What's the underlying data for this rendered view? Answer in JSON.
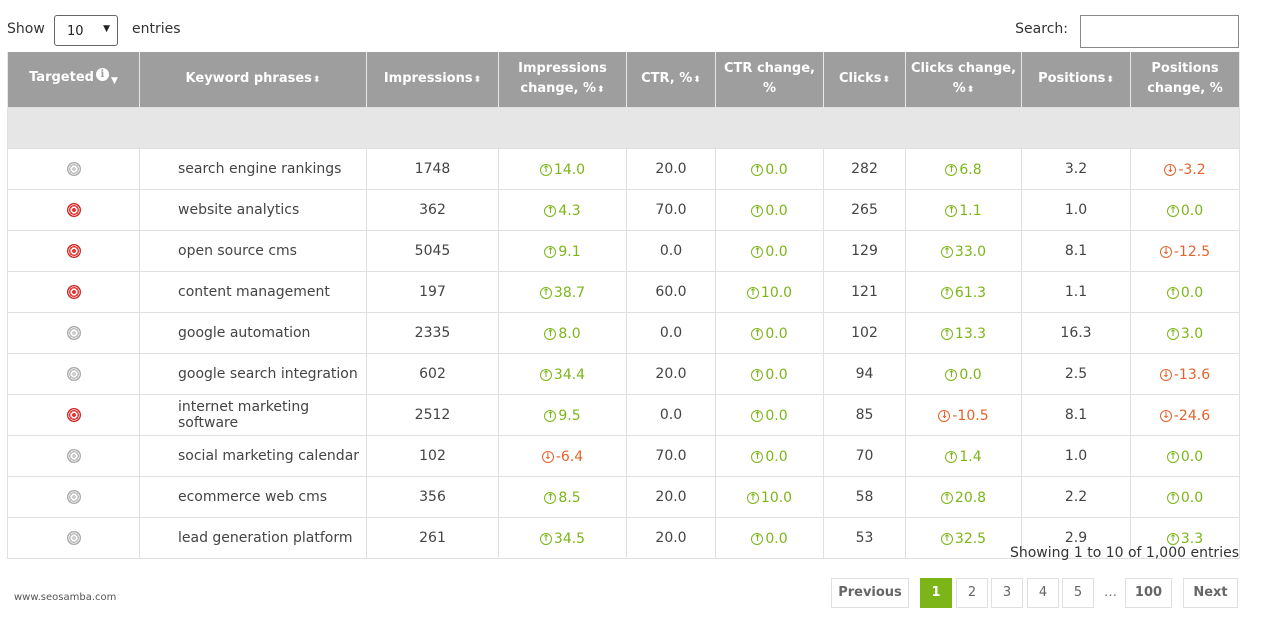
{
  "controls": {
    "show_label": "Show",
    "entries_value": "10",
    "entries_label": "entries",
    "search_label": "Search:",
    "search_value": ""
  },
  "headers": [
    "Targeted",
    "Keyword phrases",
    "Impressions",
    "Impressions change, %",
    "CTR, %",
    "CTR change, %",
    "Clicks",
    "Clicks change, %",
    "Positions",
    "Positions change, %"
  ],
  "rows": [
    {
      "targeted": false,
      "keyword": "search engine rankings",
      "impressions": "1748",
      "impressions_change": "14.0",
      "ctr": "20.0",
      "ctr_change": "0.0",
      "clicks": "282",
      "clicks_change": "6.8",
      "positions": "3.2",
      "positions_change": "-3.2"
    },
    {
      "targeted": true,
      "keyword": "website analytics",
      "impressions": "362",
      "impressions_change": "4.3",
      "ctr": "70.0",
      "ctr_change": "0.0",
      "clicks": "265",
      "clicks_change": "1.1",
      "positions": "1.0",
      "positions_change": "0.0"
    },
    {
      "targeted": true,
      "keyword": "open source cms",
      "impressions": "5045",
      "impressions_change": "9.1",
      "ctr": "0.0",
      "ctr_change": "0.0",
      "clicks": "129",
      "clicks_change": "33.0",
      "positions": "8.1",
      "positions_change": "-12.5"
    },
    {
      "targeted": true,
      "keyword": "content management",
      "impressions": "197",
      "impressions_change": "38.7",
      "ctr": "60.0",
      "ctr_change": "10.0",
      "clicks": "121",
      "clicks_change": "61.3",
      "positions": "1.1",
      "positions_change": "0.0"
    },
    {
      "targeted": false,
      "keyword": "google automation",
      "impressions": "2335",
      "impressions_change": "8.0",
      "ctr": "0.0",
      "ctr_change": "0.0",
      "clicks": "102",
      "clicks_change": "13.3",
      "positions": "16.3",
      "positions_change": "3.0"
    },
    {
      "targeted": false,
      "keyword": "google search integration",
      "impressions": "602",
      "impressions_change": "34.4",
      "ctr": "20.0",
      "ctr_change": "0.0",
      "clicks": "94",
      "clicks_change": "0.0",
      "positions": "2.5",
      "positions_change": "-13.6"
    },
    {
      "targeted": true,
      "keyword": "internet marketing software",
      "impressions": "2512",
      "impressions_change": "9.5",
      "ctr": "0.0",
      "ctr_change": "0.0",
      "clicks": "85",
      "clicks_change": "-10.5",
      "positions": "8.1",
      "positions_change": "-24.6"
    },
    {
      "targeted": false,
      "keyword": "social marketing calendar",
      "impressions": "102",
      "impressions_change": "-6.4",
      "ctr": "70.0",
      "ctr_change": "0.0",
      "clicks": "70",
      "clicks_change": "1.4",
      "positions": "1.0",
      "positions_change": "0.0"
    },
    {
      "targeted": false,
      "keyword": "ecommerce web cms",
      "impressions": "356",
      "impressions_change": "8.5",
      "ctr": "20.0",
      "ctr_change": "10.0",
      "clicks": "58",
      "clicks_change": "20.8",
      "positions": "2.2",
      "positions_change": "0.0"
    },
    {
      "targeted": false,
      "keyword": "lead generation platform",
      "impressions": "261",
      "impressions_change": "34.5",
      "ctr": "20.0",
      "ctr_change": "0.0",
      "clicks": "53",
      "clicks_change": "32.5",
      "positions": "2.9",
      "positions_change": "3.3"
    }
  ],
  "footer": {
    "showing": "Showing 1 to 10 of 1,000 entries",
    "brand": "www.seosamba.com"
  },
  "pagination": {
    "previous": "Previous",
    "pages": [
      "1",
      "2",
      "3",
      "4",
      "5"
    ],
    "ellipsis": "…",
    "last": "100",
    "next": "Next",
    "active": "1"
  },
  "icons": {
    "up": "arrow-up-circle-icon",
    "down": "arrow-down-circle-icon",
    "targeted_on": "target-red-icon",
    "targeted_off": "target-gray-icon",
    "info": "info-icon",
    "sort": "sort-icon"
  },
  "colors": {
    "header_bg": "#9e9e9e",
    "positive": "#7cb518",
    "negative": "#e5622c",
    "active_page": "#7cb518",
    "target_on": "#e53935"
  }
}
